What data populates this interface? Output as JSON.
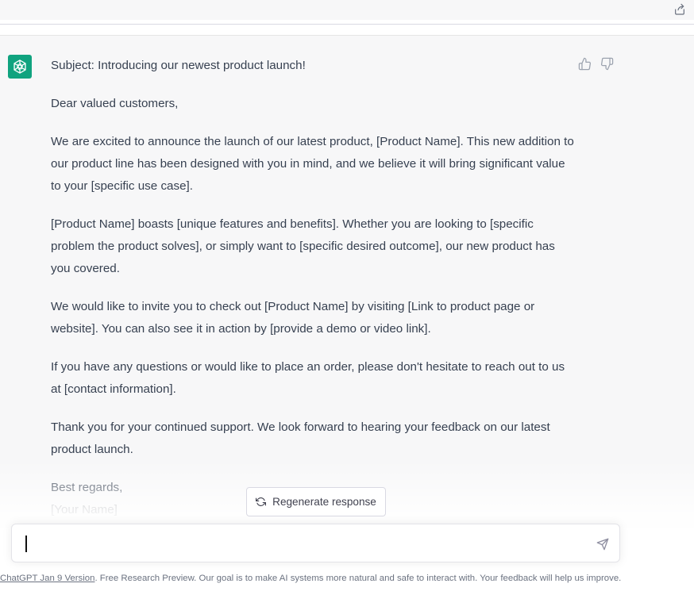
{
  "header": {
    "share_icon": "share-icon"
  },
  "message": {
    "avatar_icon": "openai-logo-icon",
    "avatar_color": "#10a37f",
    "paragraphs": [
      "Subject: Introducing our newest product launch!",
      "Dear valued customers,",
      "We are excited to announce the launch of our latest product, [Product Name]. This new addition to our product line has been designed with you in mind, and we believe it will bring significant value to your [specific use case].",
      "[Product Name] boasts [unique features and benefits]. Whether you are looking to [specific problem the product solves], or simply want to [specific desired outcome], our new product has you covered.",
      "We would like to invite you to check out [Product Name] by visiting [Link to product page or website]. You can also see it in action by [provide a demo or video link].",
      "If you have any questions or would like to place an order, please don't hesitate to reach out to us at [contact information].",
      "Thank you for your continued support. We look forward to hearing your feedback on our latest product launch.",
      "Best regards,",
      "[Your Name]"
    ],
    "feedback_icons": [
      "thumbs-up-icon",
      "thumbs-down-icon"
    ]
  },
  "regenerate": {
    "label": "Regenerate response",
    "icon": "refresh-icon"
  },
  "composer": {
    "value": "",
    "placeholder": "",
    "send_icon": "send-icon"
  },
  "footer": {
    "link": "ChatGPT Jan 9 Version",
    "text": ". Free Research Preview. Our goal is to make AI systems more natural and safe to interact with. Your feedback will help us improve."
  }
}
